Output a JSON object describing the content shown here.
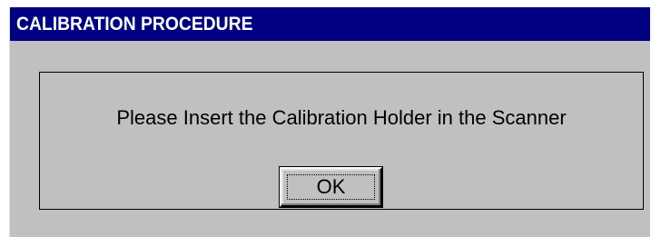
{
  "dialog": {
    "title": "CALIBRATION PROCEDURE",
    "message": "Please Insert the Calibration Holder in the Scanner",
    "ok_label": "OK"
  },
  "colors": {
    "titlebar": "#000080",
    "title_text": "#ffffff",
    "window_bg": "#c0c0c0"
  }
}
